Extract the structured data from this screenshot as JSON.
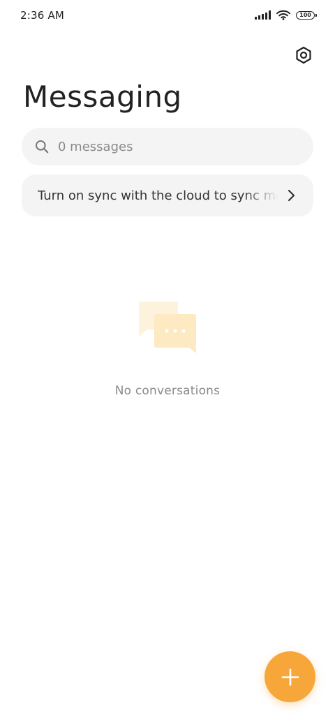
{
  "status_bar": {
    "time": "2:36 AM",
    "battery": "100",
    "icons": [
      "signal-icon",
      "wifi-icon",
      "battery-icon"
    ]
  },
  "header": {
    "title": "Messaging",
    "settings_icon": "gear-icon"
  },
  "search": {
    "placeholder": "0 messages",
    "value": ""
  },
  "sync_banner": {
    "text": "Turn on sync with the cloud to sync messages",
    "icon": "chevron-right-icon"
  },
  "empty_state": {
    "text": "No conversations",
    "icon": "chat-bubbles-icon"
  },
  "fab": {
    "icon": "plus-icon"
  },
  "colors": {
    "accent": "#f7a73a",
    "illustration": "#fdefc9",
    "surface": "#f4f4f4"
  }
}
